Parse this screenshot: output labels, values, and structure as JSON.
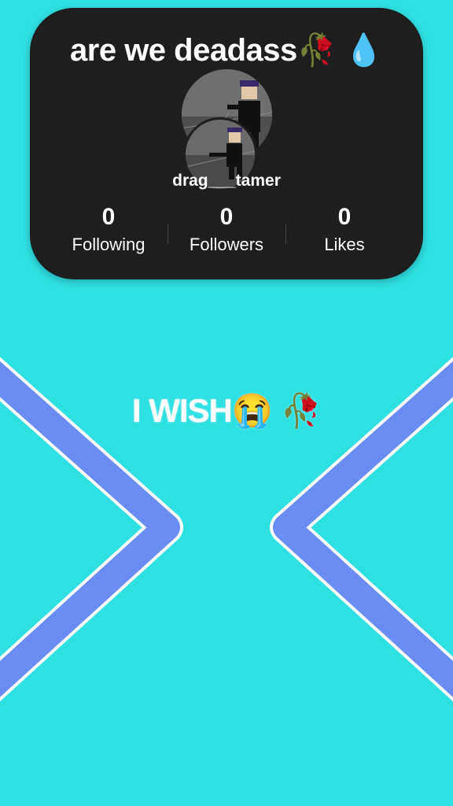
{
  "card": {
    "caption": "are we deadass🥀 💧",
    "username": "drag___tamer",
    "stats": [
      {
        "value": "0",
        "label": "Following"
      },
      {
        "value": "0",
        "label": "Followers"
      },
      {
        "value": "0",
        "label": "Likes"
      }
    ]
  },
  "overlay_text": "I WISH😭 🥀",
  "colors": {
    "background": "#2fe0e3",
    "card": "#1e1e1e",
    "chevron": "#6a8cf5",
    "chevron_outline": "#ffffff"
  }
}
